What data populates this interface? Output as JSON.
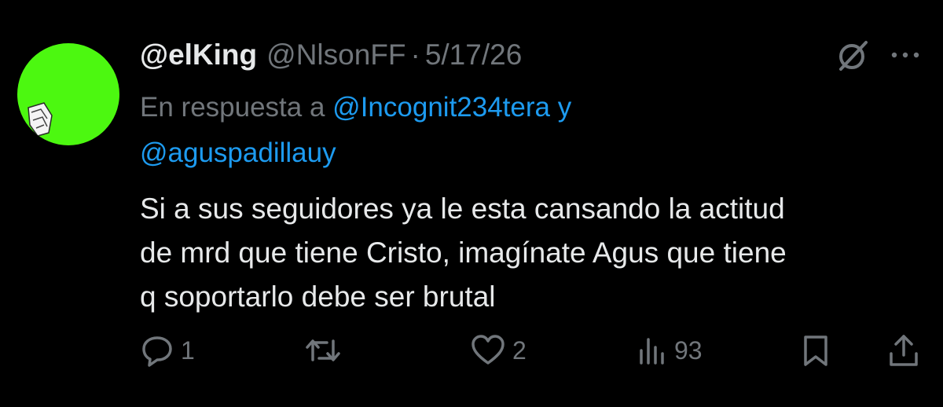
{
  "tweet": {
    "display_name": "@elKing",
    "handle": "@NlsonFF",
    "separator": "·",
    "date": "5/17/26",
    "reply_prefix": "En respuesta a",
    "reply_mention_1": "@Incognit234tera",
    "reply_conjunction": "y",
    "reply_mention_2": "@aguspadillauy",
    "text_line_1": "Si a sus seguidores ya le esta cansando la actitud",
    "text_line_2": "de mrd que tiene Cristo, imagínate Agus que tiene",
    "text_line_3": "q soportarlo debe ser brutal",
    "avatar_color": "#4cf810"
  },
  "actions": {
    "reply_count": "1",
    "retweet_count": "",
    "like_count": "2",
    "views_count": "93"
  },
  "icons": {
    "grok": "grok-slash-circle-icon",
    "more": "more-dots-icon",
    "reply": "reply-bubble-icon",
    "retweet": "retweet-arrows-icon",
    "like": "heart-icon",
    "views": "views-bars-icon",
    "bookmark": "bookmark-icon",
    "share": "share-upload-icon"
  },
  "colors": {
    "background": "#000000",
    "text_primary": "#e7e9ea",
    "text_secondary": "#71767b",
    "accent": "#1d9bf0"
  }
}
